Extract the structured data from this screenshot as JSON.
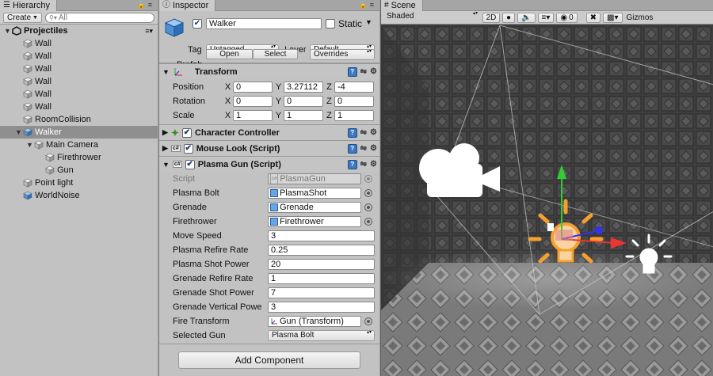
{
  "hierarchy": {
    "tab_label": "Hierarchy",
    "create_label": "Create",
    "search_placeholder": "All",
    "items": [
      {
        "label": "Projectiles",
        "depth": 0,
        "icon": "unity-scene-icon",
        "expanded": true,
        "selected": false,
        "bold": true
      },
      {
        "label": "Wall",
        "depth": 1,
        "icon": "gameobject-icon"
      },
      {
        "label": "Wall",
        "depth": 1,
        "icon": "gameobject-icon"
      },
      {
        "label": "Wall",
        "depth": 1,
        "icon": "gameobject-icon"
      },
      {
        "label": "Wall",
        "depth": 1,
        "icon": "gameobject-icon"
      },
      {
        "label": "Wall",
        "depth": 1,
        "icon": "gameobject-icon"
      },
      {
        "label": "Wall",
        "depth": 1,
        "icon": "gameobject-icon"
      },
      {
        "label": "RoomCollision",
        "depth": 1,
        "icon": "gameobject-icon"
      },
      {
        "label": "Walker",
        "depth": 1,
        "icon": "prefab-icon",
        "expanded": true,
        "selected": true
      },
      {
        "label": "Main Camera",
        "depth": 2,
        "icon": "gameobject-icon",
        "expanded": true
      },
      {
        "label": "Firethrower",
        "depth": 3,
        "icon": "gameobject-icon"
      },
      {
        "label": "Gun",
        "depth": 3,
        "icon": "gameobject-icon"
      },
      {
        "label": "Point light",
        "depth": 1,
        "icon": "gameobject-icon"
      },
      {
        "label": "WorldNoise",
        "depth": 1,
        "icon": "prefab-icon"
      }
    ]
  },
  "inspector": {
    "tab_label": "Inspector",
    "object_name": "Walker",
    "static_label": "Static",
    "tag_label": "Tag",
    "tag_value": "Untagged",
    "layer_label": "Layer",
    "layer_value": "Default",
    "prefab_label": "Prefab",
    "open_label": "Open",
    "select_label": "Select",
    "overrides_label": "Overrides",
    "transform": {
      "title": "Transform",
      "rows": [
        {
          "label": "Position",
          "x": "0",
          "y": "3.27112",
          "z": "-4"
        },
        {
          "label": "Rotation",
          "x": "0",
          "y": "0",
          "z": "0"
        },
        {
          "label": "Scale",
          "x": "1",
          "y": "1",
          "z": "1"
        }
      ]
    },
    "components": [
      {
        "title": "Character Controller",
        "icon": "character-controller-icon"
      },
      {
        "title": "Mouse Look (Script)",
        "icon": "script-icon"
      }
    ],
    "plasma_gun": {
      "title": "Plasma Gun (Script)",
      "script_label": "Script",
      "script_value": "PlasmaGun",
      "plasma_bolt_label": "Plasma Bolt",
      "plasma_bolt_value": "PlasmaShot",
      "grenade_label": "Grenade",
      "grenade_value": "Grenade",
      "firethrower_label": "Firethrower",
      "firethrower_value": "Firethrower",
      "move_speed_label": "Move Speed",
      "move_speed_value": "3",
      "refire_label": "Plasma Refire Rate",
      "refire_value": "0.25",
      "shot_power_label": "Plasma Shot Power",
      "shot_power_value": "20",
      "grenade_refire_label": "Grenade Refire Rate",
      "grenade_refire_value": "1",
      "grenade_shot_label": "Grenade Shot Power",
      "grenade_shot_value": "7",
      "grenade_vertical_label": "Grenade Vertical Powe",
      "grenade_vertical_value": "3",
      "fire_transform_label": "Fire Transform",
      "fire_transform_value": "Gun (Transform)",
      "selected_gun_label": "Selected Gun",
      "selected_gun_value": "Plasma Bolt"
    },
    "add_component_label": "Add Component"
  },
  "scene": {
    "tab_label": "Scene",
    "shading_value": "Shaded",
    "mode_2d_label": "2D",
    "fx_count": "0",
    "gizmos_label": "Gizmos"
  }
}
